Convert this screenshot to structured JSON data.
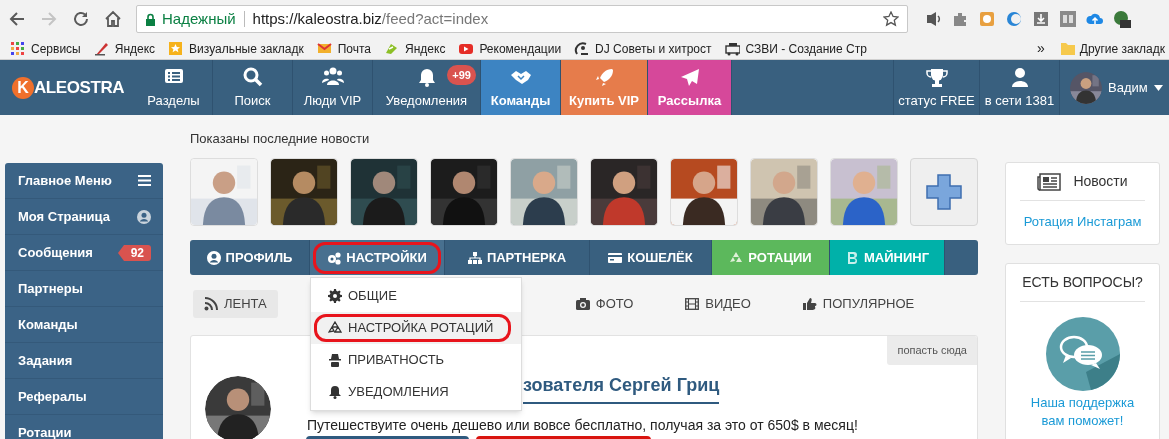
{
  "browser": {
    "security_label": "Надежный",
    "url_host": "https://kaleostra.biz",
    "url_path": "/feed?act=index",
    "bookmarks": [
      {
        "label": "Сервисы"
      },
      {
        "label": "Яндекс"
      },
      {
        "label": "Визуальные закладк"
      },
      {
        "label": "Почта"
      },
      {
        "label": "Яндекс"
      },
      {
        "label": "Рекомендации"
      },
      {
        "label": "DJ Советы и хитрост"
      },
      {
        "label": "СЗВИ - Создание Стр"
      }
    ],
    "overflow": "»",
    "other_bookmarks": "Другие закладк"
  },
  "site": {
    "logo_letter": "K",
    "logo_text": "ALEOSTRA"
  },
  "nav": [
    {
      "label": "Разделы"
    },
    {
      "label": "Поиск"
    },
    {
      "label": "Люди VIP"
    },
    {
      "label": "Уведомления",
      "badge": "+99"
    },
    {
      "label": "Команды",
      "color": "#3d84c2"
    },
    {
      "label": "Купить VIP",
      "color": "#e67c4b"
    },
    {
      "label": "Рассылка",
      "color": "#d6489a"
    }
  ],
  "nav_right": [
    {
      "label": "статус FREE"
    },
    {
      "label": "в сети 1381"
    }
  ],
  "user": {
    "name": "Вадим"
  },
  "sidebar": [
    {
      "label": "Главное Меню"
    },
    {
      "label": "Моя Страница"
    },
    {
      "label": "Сообщения",
      "badge": "92"
    },
    {
      "label": "Партнеры"
    },
    {
      "label": "Команды"
    },
    {
      "label": "Задания"
    },
    {
      "label": "Рефералы"
    },
    {
      "label": "Ротации"
    }
  ],
  "feed_heading": "Показаны последние новости",
  "news_avatars": [
    {
      "kind": "picture"
    },
    {
      "kind": "picture"
    },
    {
      "kind": "picture"
    },
    {
      "kind": "picture"
    },
    {
      "kind": "picture"
    },
    {
      "kind": "picture"
    },
    {
      "kind": "picture"
    },
    {
      "kind": "picture"
    },
    {
      "kind": "picture"
    },
    {
      "kind": "add"
    }
  ],
  "profile_tabs": [
    {
      "label": "ПРОФИЛЬ",
      "selected": false,
      "annotated": false
    },
    {
      "label": "НАСТРОЙКИ",
      "selected": true,
      "annotated": true
    },
    {
      "label": "ПАРТНЕРКА",
      "selected": false,
      "annotated": false
    },
    {
      "label": "КОШЕЛЁК",
      "selected": false,
      "annotated": false
    },
    {
      "label": "РОТАЦИИ",
      "selected": false,
      "annotated": false,
      "color": "#5cb85c"
    },
    {
      "label": "МАЙНИНГ",
      "selected": false,
      "annotated": false,
      "color": "#00b1a9"
    }
  ],
  "settings_menu": [
    {
      "label": "ОБЩИЕ",
      "selected": false,
      "annotated": false
    },
    {
      "label": "НАСТРОЙКА РОТАЦИЙ",
      "selected": true,
      "annotated": true
    },
    {
      "label": "ПРИВАТНОСТЬ",
      "selected": false,
      "annotated": false
    },
    {
      "label": "УВЕДОМЛЕНИЯ",
      "selected": false,
      "annotated": false
    }
  ],
  "feed_tabs": [
    {
      "label": "ЛЕНТА",
      "selected": true
    },
    {
      "label": "ФОТО",
      "selected": false
    },
    {
      "label": "ВИДЕО",
      "selected": false
    },
    {
      "label": "ПОПУЛЯРНОЕ",
      "selected": false
    }
  ],
  "post": {
    "pin_label": "попасть сюда",
    "title": "зователя Сергей Гриц",
    "text": "Путешествуите очень дешево или вовсе бесплатно, получая за это от 650$ в месяц!"
  },
  "news_widget": {
    "title": "Новости",
    "link": "Ротация Инстаграм"
  },
  "support_widget": {
    "title": "ЕСТЬ ВОПРОСЫ?",
    "text": "Наша поддержка вам поможет!"
  }
}
